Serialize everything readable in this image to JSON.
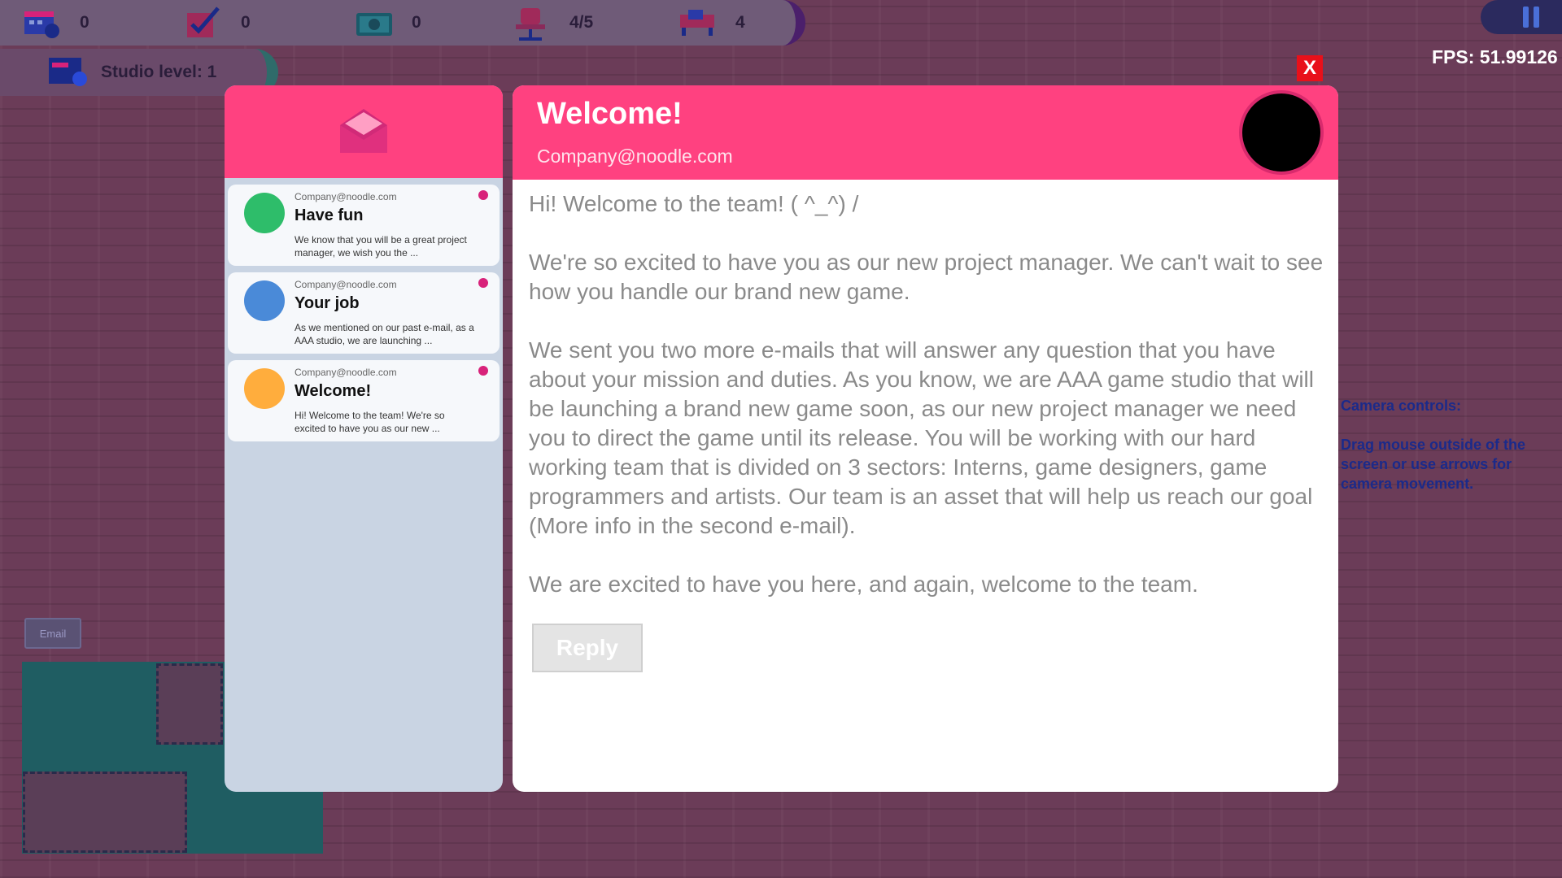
{
  "hud": {
    "stats": [
      {
        "name": "projects",
        "value": "0"
      },
      {
        "name": "tasks",
        "value": "0"
      },
      {
        "name": "money",
        "value": "0"
      },
      {
        "name": "staff",
        "value": "4/5"
      },
      {
        "name": "desks",
        "value": "4"
      }
    ],
    "studio_level": "Studio level: 1",
    "fps": "FPS: 51.99126"
  },
  "camera_info": {
    "title": "Camera controls:",
    "text": "Drag mouse outside of the screen or use arrows for camera movement."
  },
  "email_button_label": "Email",
  "inbox": {
    "items": [
      {
        "from": "Company@noodle.com",
        "subject": "Have fun",
        "preview": "We know that you will be a great project manager, we wish you the ...",
        "avatar_color": "#2ebd6a",
        "unread_color": "#d8227a"
      },
      {
        "from": "Company@noodle.com",
        "subject": "Your job",
        "preview": "As we mentioned on our past e-mail, as a AAA studio, we are launching ...",
        "avatar_color": "#4a8ad8",
        "unread_color": "#d8227a"
      },
      {
        "from": "Company@noodle.com",
        "subject": "Welcome!",
        "preview": "Hi! Welcome to the team! We're so excited to have you as our new ...",
        "avatar_color": "#ffad3d",
        "unread_color": "#d8227a"
      }
    ]
  },
  "reader": {
    "title": "Welcome!",
    "from": "Company@noodle.com",
    "paragraphs": [
      "Hi! Welcome to the team!  ( ^_^) /",
      "We're so excited to have you as our new project manager. We can't wait to see how you handle our brand new game.",
      "We sent you two more e-mails that will answer any question that you have about your mission and duties. As you know, we are AAA game studio that will be launching a brand new game soon, as our new project manager we need you to direct the game until its release. You will be working with our hard working team that is divided on 3 sectors: Interns, game designers, game programmers and artists. Our team is an asset that will help us reach our goal (More info in the second e-mail).",
      "We are excited to have you here, and again, welcome to the team."
    ],
    "reply_label": "Reply"
  },
  "close_label": "X",
  "colors": {
    "accent": "#ff4180",
    "close": "#e8101a"
  }
}
